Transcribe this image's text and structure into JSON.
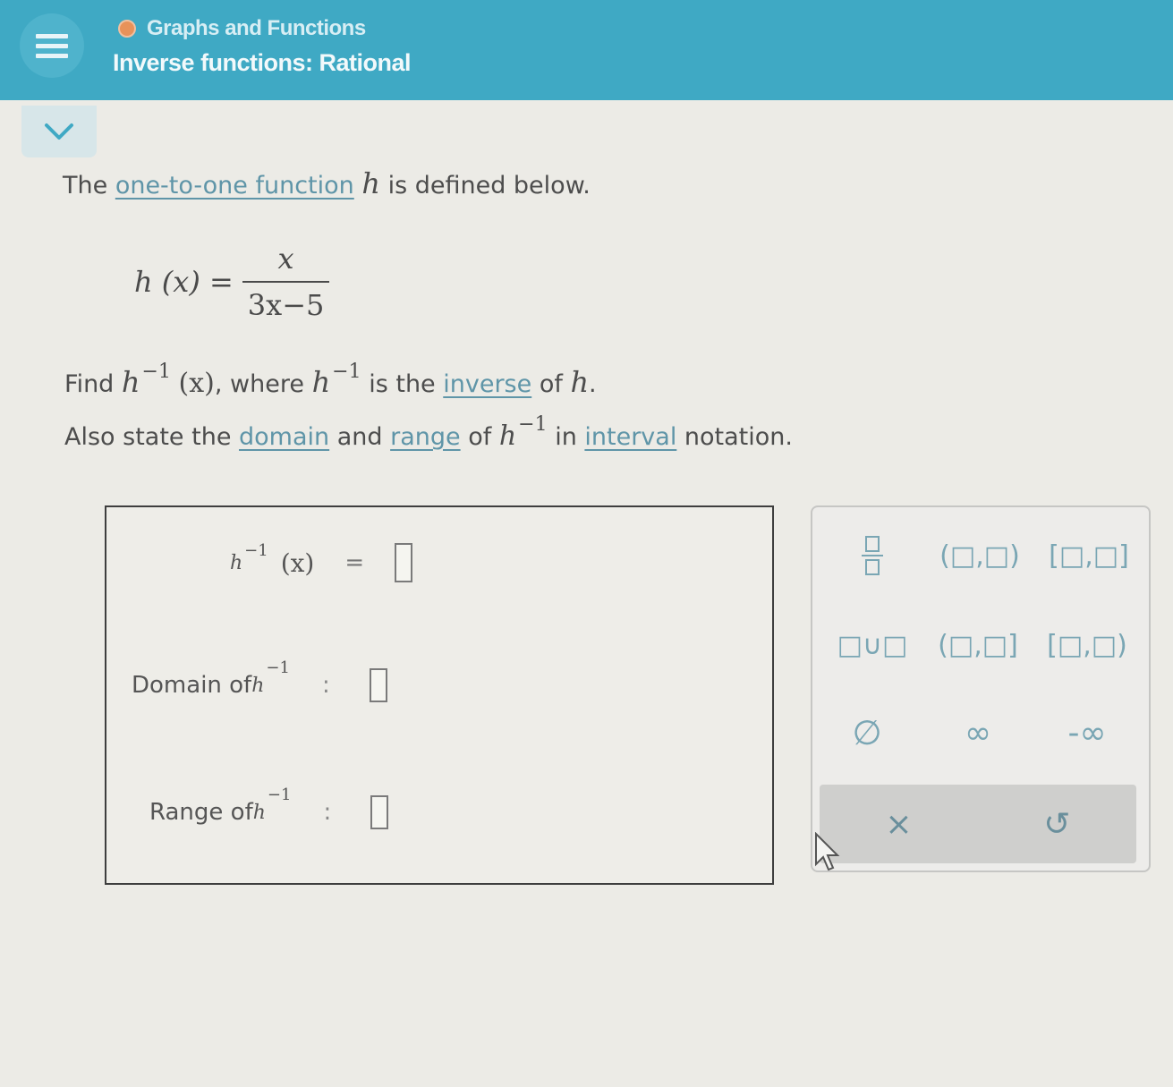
{
  "header": {
    "breadcrumb": "Graphs and Functions",
    "topic": "Inverse functions: Rational",
    "accent_color": "#3fa9c4"
  },
  "problem": {
    "line1_pre": "The ",
    "line1_link": "one-to-one function",
    "line1_var": "h",
    "line1_post": " is defined below.",
    "eq_lhs": "h (x) =",
    "eq_num": "x",
    "eq_den": "3x−5",
    "line2_find": "Find ",
    "line2_fn": "h",
    "line2_exp": "−1",
    "line2_arg": "(x)",
    "line2_where": ", where ",
    "line2_fn2": "h",
    "line2_exp2": "−1",
    "line2_is": " is the ",
    "line2_link": "inverse",
    "line2_of": " of ",
    "line2_h": "h",
    "line2_dot": ".",
    "line3_pre": "Also state the ",
    "line3_link1": "domain",
    "line3_and": " and ",
    "line3_link2": "range",
    "line3_of": " of ",
    "line3_fn": "h",
    "line3_exp": "−1",
    "line3_in": " in ",
    "line3_link3": "interval",
    "line3_post": " notation."
  },
  "answers": {
    "inverse_label_fn": "h",
    "inverse_label_exp": "−1",
    "inverse_label_arg": "(x)",
    "inverse_eq": "=",
    "domain_label": "Domain of ",
    "domain_fn": "h",
    "domain_exp": "−1",
    "domain_colon": ":",
    "range_label": "Range of ",
    "range_fn": "h",
    "range_exp": "−1",
    "range_colon": ":"
  },
  "palette": {
    "open_open": "(□,□)",
    "closed_closed": "[□,□]",
    "union": "□∪□",
    "open_closed": "(□,□]",
    "closed_open": "[□,□)",
    "empty_set": "∅",
    "infinity": "∞",
    "neg_infinity": "-∞",
    "clear": "×",
    "undo": "↺"
  }
}
